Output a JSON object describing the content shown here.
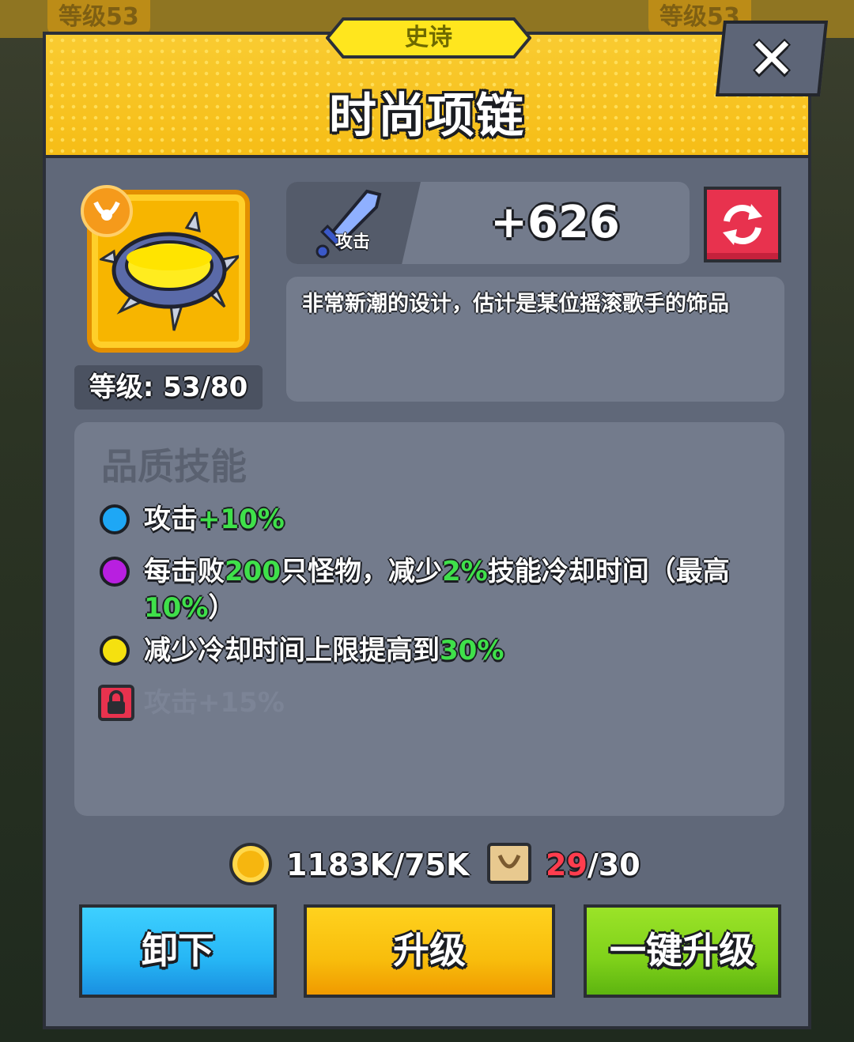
{
  "background": {
    "tags": [
      "等级53",
      "等级53"
    ]
  },
  "rarity": "史诗",
  "title": "时尚项链",
  "close_label": "✕",
  "item": {
    "level": "等级: 53/80"
  },
  "stat": {
    "label": "攻击",
    "value": "+626"
  },
  "description": "非常新潮的设计，估计是某位摇滚歌手的饰品",
  "skills": {
    "title": "品质技能",
    "items": [
      {
        "color": "#1ea7f5",
        "parts": [
          "攻击",
          "+10%"
        ]
      },
      {
        "color": "#b81fe0",
        "parts": [
          "每击败",
          "200",
          "只怪物，减少",
          "2%",
          "技能冷却时间（最高",
          "10%",
          "）"
        ]
      },
      {
        "color": "#f5e10f",
        "parts": [
          "减少冷却时间上限提高到",
          "30%"
        ]
      },
      {
        "locked": true,
        "text": "攻击+15%"
      }
    ]
  },
  "cost": {
    "gold": "1183K/75K",
    "scroll_have": "29",
    "scroll_need": "/30"
  },
  "buttons": {
    "unequip": "卸下",
    "upgrade": "升级",
    "upgrade_all": "一键升级"
  },
  "colors": {
    "header": "#f6bd16",
    "panel": "#606879",
    "green_text": "#3fe04a",
    "red_text": "#ff3d4e"
  }
}
